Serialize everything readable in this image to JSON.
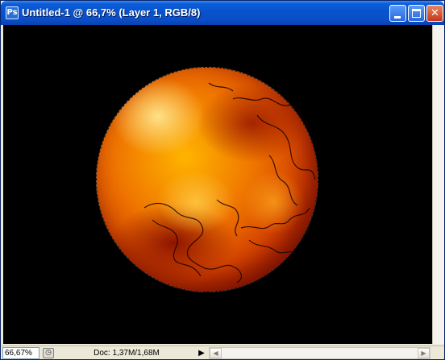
{
  "window": {
    "title": "Untitled-1 @ 66,7% (Layer 1, RGB/8)",
    "app_icon": "photoshop-document-icon",
    "app_icon_glyph": "Ps",
    "controls": {
      "minimize": "minimize-icon",
      "maximize": "maximize-icon",
      "close": "close-icon",
      "close_glyph": "✕"
    }
  },
  "canvas": {
    "background": "#000000",
    "layer_content": "orange-red planet sphere with circular marquee selection"
  },
  "status_bar": {
    "zoom": "66,67%",
    "doc_info": "Doc: 1,37M/1,68M",
    "menu_arrow": "▶",
    "status_icon_glyph": "◷"
  },
  "scrollbars": {
    "left_arrow": "◀",
    "right_arrow": "▶"
  },
  "colors": {
    "titlebar": "#0a5ed8",
    "close_button": "#c6371b",
    "planet_core": "#f07800"
  }
}
